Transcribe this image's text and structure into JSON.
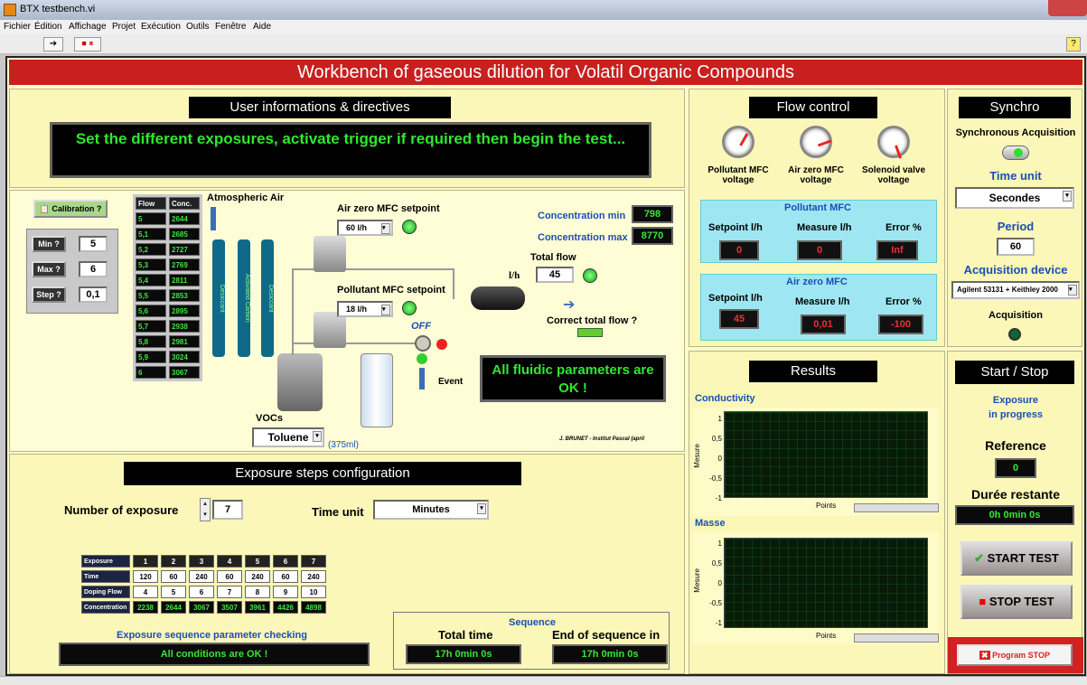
{
  "window": {
    "title": "BTX testbench.vi"
  },
  "menu": [
    "Fichier",
    "Édition",
    "Affichage",
    "Projet",
    "Exécution",
    "Outils",
    "Fenêtre",
    "Aide"
  ],
  "toolbar": {
    "run": "➔",
    "stop": "⏹ ⏸",
    "help": "?"
  },
  "app": {
    "title": "Workbench of gaseous dilution for Volatil Organic Compounds"
  },
  "user_info": {
    "header": "User informations & directives",
    "message": "Set the different exposures, activate trigger if required then begin the test..."
  },
  "calib": {
    "button": "Calibration ?",
    "min_label": "Min ?",
    "min_value": "5",
    "max_label": "Max ?",
    "max_value": "6",
    "step_label": "Step ?",
    "step_value": "0,1"
  },
  "flow_table": {
    "headers": [
      "Flow",
      "Conc."
    ],
    "rows": [
      [
        "5",
        "2644"
      ],
      [
        "5,1",
        "2685"
      ],
      [
        "5,2",
        "2727"
      ],
      [
        "5,3",
        "2769"
      ],
      [
        "5,4",
        "2811"
      ],
      [
        "5,5",
        "2853"
      ],
      [
        "5,6",
        "2895"
      ],
      [
        "5,7",
        "2938"
      ],
      [
        "5,8",
        "2981"
      ],
      [
        "5,9",
        "3024"
      ],
      [
        "6",
        "3067"
      ]
    ]
  },
  "diagram": {
    "atm_air": "Atmospheric Air",
    "air_zero_label": "Air zero MFC setpoint",
    "air_zero_value": "60 l/h",
    "pollutant_label": "Pollutant MFC setpoint",
    "pollutant_value": "18 l/h",
    "conc_min_label": "Concentration min",
    "conc_min_value": "798",
    "conc_max_label": "Concentration max",
    "conc_max_value": "8770",
    "total_flow_label": "Total flow",
    "total_flow_unit": "l/h",
    "total_flow_value": "45",
    "correct_flow": "Correct total flow ?",
    "off": "OFF",
    "event": "Event",
    "fluidic_msg": "All fluidic parameters are OK !",
    "vocs_label": "VOCs",
    "vocs_value": "Toluene",
    "volume": "(375ml)",
    "credit": "J. BRUNET - Institut Pascal (april",
    "desiccant1": "Desiccant",
    "carbon": "Activated Carbon",
    "desiccant2": "Desiccant"
  },
  "exposure": {
    "header": "Exposure steps configuration",
    "num_label": "Number of  exposure",
    "num_value": "7",
    "time_unit_label": "Time unit",
    "time_unit_value": "Minutes",
    "row_labels": [
      "Exposure",
      "Time",
      "Doping Flow",
      "Concentration"
    ],
    "rows": [
      [
        "1",
        "2",
        "3",
        "4",
        "5",
        "6",
        "7"
      ],
      [
        "120",
        "60",
        "240",
        "60",
        "240",
        "60",
        "240"
      ],
      [
        "4",
        "5",
        "6",
        "7",
        "8",
        "9",
        "10"
      ],
      [
        "2238",
        "2644",
        "3067",
        "3507",
        "3961",
        "4426",
        "4898"
      ]
    ],
    "check_label": "Exposure sequence parameter checking",
    "check_msg": "All conditions are OK !",
    "sequence_label": "Sequence",
    "total_time_label": "Total time",
    "total_time_value": "17h 0min 0s",
    "end_label": "End of sequence in",
    "end_value": "17h 0min 0s"
  },
  "flow_control": {
    "header": "Flow control",
    "gauges": [
      {
        "label": "Pollutant MFC voltage",
        "text": "2,3\n1    4"
      },
      {
        "label": "Air zero MFC voltage",
        "text": "2,3\n1    4\n0,5"
      },
      {
        "label": "Solenoid valve voltage",
        "text": "2,3\n1    4\n5"
      }
    ],
    "pollutant": {
      "title": "Pollutant MFC",
      "setpoint_label": "Setpoint l/h",
      "setpoint": "0",
      "measure_label": "Measure l/h",
      "measure": "0",
      "error_label": "Error %",
      "error": "Inf"
    },
    "airzero": {
      "title": "Air zero MFC",
      "setpoint_label": "Setpoint l/h",
      "setpoint": "45",
      "measure_label": "Measure l/h",
      "measure": "0,01",
      "error_label": "Error %",
      "error": "-100"
    }
  },
  "synchro": {
    "header": "Synchro",
    "sync_label": "Synchronous Acquisition",
    "time_unit_label": "Time unit",
    "time_unit_value": "Secondes",
    "period_label": "Period",
    "period_value": "60",
    "device_label": "Acquisition device",
    "device_value": "Agilent 53131 + Keithley 2000",
    "acq_label": "Acquisition"
  },
  "results": {
    "header": "Results",
    "chart1_title": "Conductivity",
    "chart2_title": "Masse",
    "y_axis": "Mesure",
    "x_axis": "Points",
    "yticks": [
      "1",
      "0,5",
      "0",
      "-0,5",
      "-1"
    ]
  },
  "startstop": {
    "header": "Start / Stop",
    "status": "Exposure\nin progress",
    "ref_label": "Reference",
    "ref_value": "0",
    "remaining_label": "Durée restante",
    "remaining_value": "0h 0min 0s",
    "start": "START TEST",
    "stop": "STOP TEST",
    "program_stop": "Program STOP"
  },
  "colors": {
    "accent_red": "#c81f1f",
    "panel_yellow": "#fbf7b8",
    "led_green": "#33dd33",
    "indicator_green": "#37e637"
  }
}
